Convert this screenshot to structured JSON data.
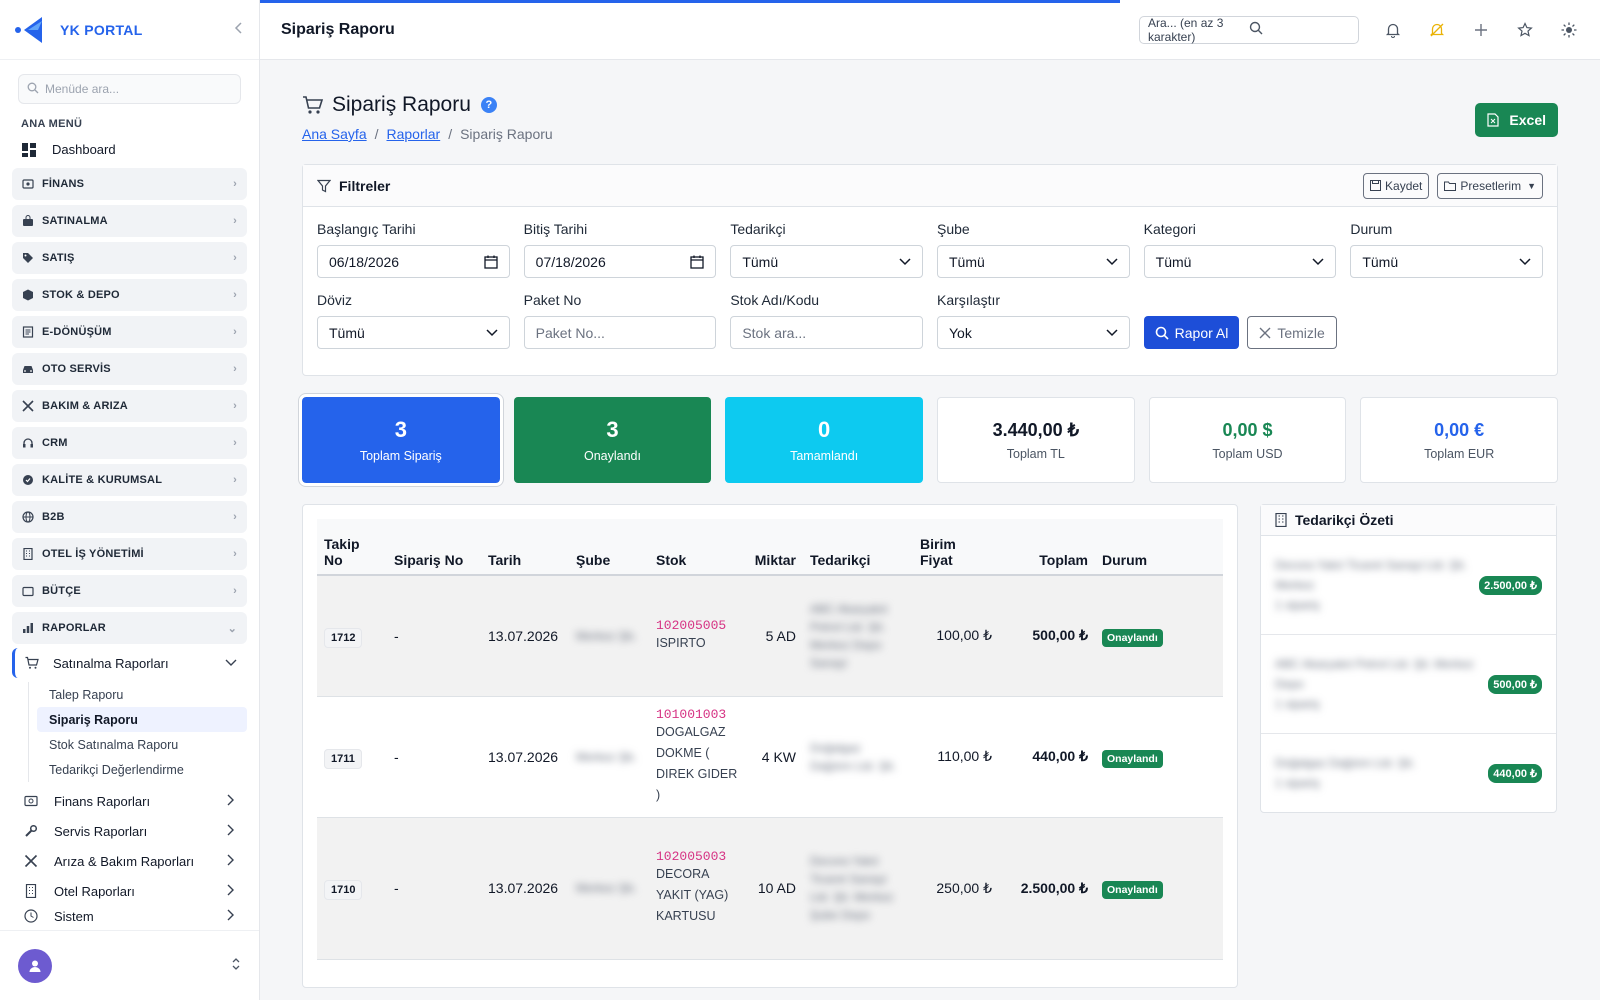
{
  "brand": {
    "name": "YK PORTAL"
  },
  "sidebar": {
    "search_placeholder": "Menüde ara...",
    "menu_title": "ANA MENÜ",
    "dashboard": "Dashboard",
    "groups": [
      {
        "label": "FİNANS",
        "icon": "finance-icon"
      },
      {
        "label": "SATINALMA",
        "icon": "bag-icon"
      },
      {
        "label": "SATIŞ",
        "icon": "tag-icon"
      },
      {
        "label": "STOK & DEPO",
        "icon": "box-icon"
      },
      {
        "label": "E-DÖNÜŞÜM",
        "icon": "document-icon"
      },
      {
        "label": "OTO SERVİS",
        "icon": "car-icon"
      },
      {
        "label": "BAKIM & ARIZA",
        "icon": "tools-icon"
      },
      {
        "label": "CRM",
        "icon": "headset-icon"
      },
      {
        "label": "KALİTE & KURUMSAL",
        "icon": "award-icon"
      },
      {
        "label": "B2B",
        "icon": "globe-icon"
      },
      {
        "label": "OTEL İŞ YÖNETİMİ",
        "icon": "building-icon"
      },
      {
        "label": "BÜTÇE",
        "icon": "wallet-icon"
      },
      {
        "label": "RAPORLAR",
        "icon": "chart-icon"
      }
    ],
    "open_sub": "Satınalma Raporları",
    "leaves": [
      "Talep Raporu",
      "Sipariş Raporu",
      "Stok Satınalma Raporu",
      "Tedarikçi Değerlendirme"
    ],
    "reports": [
      "Finans Raporları",
      "Servis Raporları",
      "Arıza & Bakım Raporları",
      "Otel Raporları",
      "Sistem"
    ]
  },
  "topbar": {
    "title": "Sipariş Raporu",
    "search_placeholder": "Ara... (en az 3 karakter)"
  },
  "page": {
    "title": "Sipariş Raporu",
    "help": "?",
    "breadcrumb": [
      "Ana Sayfa",
      "Raporlar",
      "Sipariş Raporu"
    ],
    "excel": "Excel"
  },
  "filters": {
    "title": "Filtreler",
    "save": "Kaydet",
    "presets": "Presetlerim",
    "start_label": "Başlangıç Tarihi",
    "start_value": "06/18/2026",
    "end_label": "Bitiş Tarihi",
    "end_value": "07/18/2026",
    "supplier_label": "Tedarikçi",
    "supplier_value": "Tümü",
    "branch_label": "Şube",
    "branch_value": "Tümü",
    "category_label": "Kategori",
    "category_value": "Tümü",
    "status_label": "Durum",
    "status_value": "Tümü",
    "currency_label": "Döviz",
    "currency_value": "Tümü",
    "package_label": "Paket No",
    "package_placeholder": "Paket No...",
    "stock_label": "Stok Adı/Kodu",
    "stock_placeholder": "Stok ara...",
    "compare_label": "Karşılaştır",
    "compare_value": "Yok",
    "run": "Rapor Al",
    "clear": "Temizle"
  },
  "stats": [
    {
      "value": "3",
      "label": "Toplam Sipariş"
    },
    {
      "value": "3",
      "label": "Onaylandı"
    },
    {
      "value": "0",
      "label": "Tamamlandı"
    },
    {
      "value": "3.440,00 ₺",
      "label": "Toplam TL"
    },
    {
      "value": "0,00 $",
      "label": "Toplam USD"
    },
    {
      "value": "0,00 €",
      "label": "Toplam EUR"
    }
  ],
  "colors": {
    "usd": "#198754",
    "eur": "#2563eb",
    "primary": "#2563eb",
    "success": "#198754",
    "info": "#0dcaf0"
  },
  "table": {
    "headers": [
      "Takip No",
      "Sipariş No",
      "Tarih",
      "Şube",
      "Stok",
      "Miktar",
      "Tedarikçi",
      "Birim Fiyat",
      "Toplam",
      "Durum"
    ],
    "rows": [
      {
        "track": "1712",
        "order": "-",
        "date": "13.07.2026",
        "branch": "Merkez Şb.",
        "code": "102005005",
        "name": "ISPIRTO",
        "qty": "5 AD",
        "supplier": "ABC Akaryakıt Petrol Ltd. Şti. Merkez Depo Sanayi",
        "unit": "100,00 ₺",
        "total": "500,00 ₺",
        "status": "Onaylandı"
      },
      {
        "track": "1711",
        "order": "-",
        "date": "13.07.2026",
        "branch": "Merkez Şb.",
        "code": "101001003",
        "name": "DOGALGAZ DOKME ( DIREK GIDER )",
        "qty": "4 KW",
        "supplier": "Doğalgaz Dağıtım Ltd. Şti.",
        "unit": "110,00 ₺",
        "total": "440,00 ₺",
        "status": "Onaylandı"
      },
      {
        "track": "1710",
        "order": "-",
        "date": "13.07.2026",
        "branch": "Merkez Şb.",
        "code": "102005003",
        "name": "DECORA YAKIT (YAG) KARTUSU",
        "qty": "10 AD",
        "supplier": "Decora Yakıt Ticaret Sanayi Ltd. Şti. Merkez Şube Depo",
        "unit": "250,00 ₺",
        "total": "2.500,00 ₺",
        "status": "Onaylandı"
      }
    ]
  },
  "supplier_summary": {
    "title": "Tedarikçi Özeti",
    "items": [
      {
        "name": "Decora Yakıt Ticaret Sanayi Ltd. Şti. Merkez",
        "sub": "1 sipariş",
        "amount": "2.500,00 ₺"
      },
      {
        "name": "ABC Akaryakıt Petrol Ltd. Şti. Merkez Depo",
        "sub": "1 sipariş",
        "amount": "500,00 ₺"
      },
      {
        "name": "Doğalgaz Dağıtım Ltd. Şti.",
        "sub": "1 sipariş",
        "amount": "440,00 ₺"
      }
    ]
  }
}
